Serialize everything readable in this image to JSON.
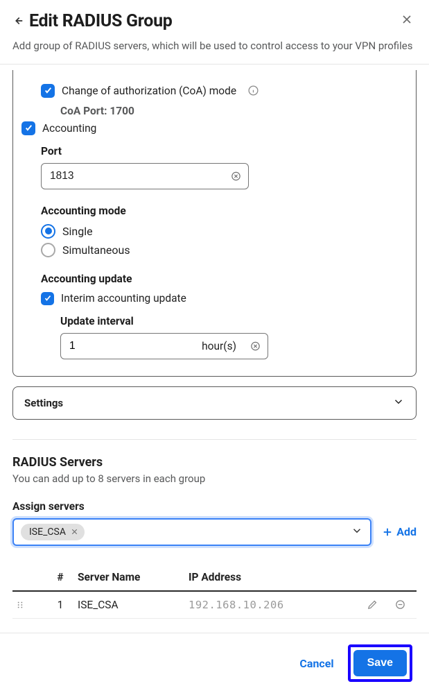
{
  "header": {
    "title": "Edit RADIUS Group",
    "subtitle": "Add group of RADIUS servers, which will be used to control access to your VPN profiles"
  },
  "panel": {
    "coa_label": "Change of authorization (CoA) mode",
    "coa_port_label": "CoA Port: 1700",
    "accounting_label": "Accounting",
    "port_label": "Port",
    "port_value": "1813",
    "mode_label": "Accounting mode",
    "mode_options": {
      "single": "Single",
      "simultaneous": "Simultaneous"
    },
    "update_label": "Accounting update",
    "interim_label": "Interim accounting update",
    "interval_label": "Update interval",
    "interval_value": "1",
    "interval_unit": "hour(s)"
  },
  "settings_expand": "Settings",
  "servers": {
    "title": "RADIUS Servers",
    "subtitle": "You can add up to 8 servers in each group",
    "assign_label": "Assign servers",
    "chip": "ISE_CSA",
    "add_label": "Add",
    "columns": {
      "num": "#",
      "name": "Server Name",
      "ip": "IP Address"
    },
    "rows": [
      {
        "num": "1",
        "name": "ISE_CSA",
        "ip": "192.168.10.206"
      }
    ]
  },
  "footer": {
    "cancel": "Cancel",
    "save": "Save"
  }
}
